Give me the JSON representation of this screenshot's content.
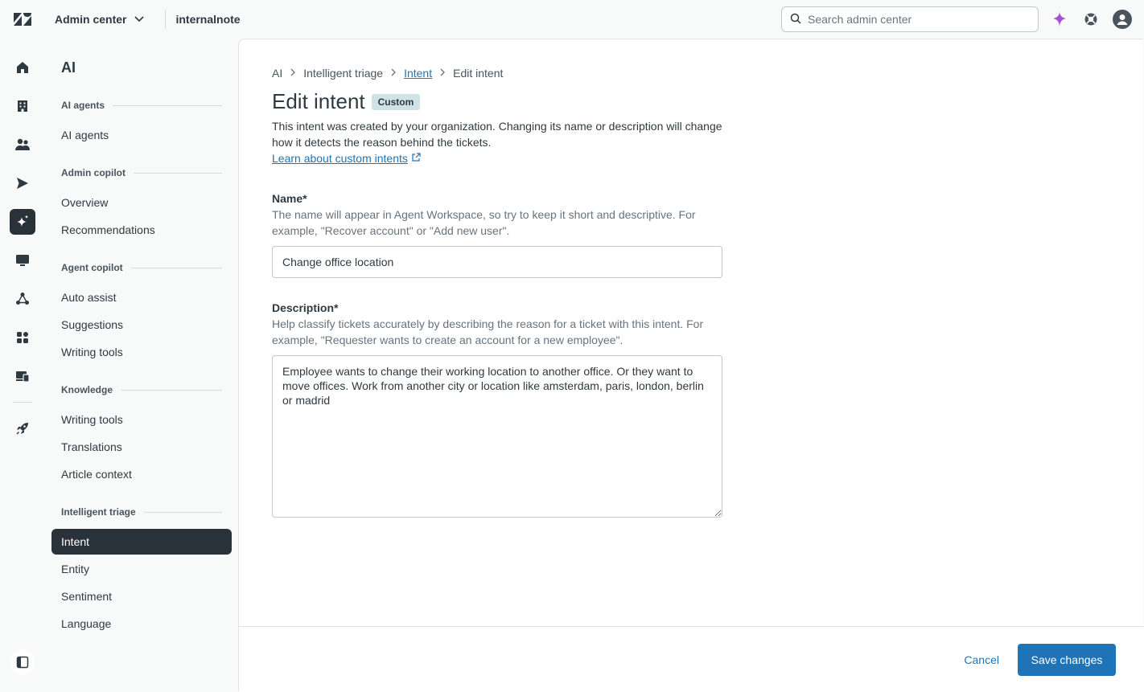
{
  "topbar": {
    "product_label": "Admin center",
    "account_name": "internalnote",
    "search_placeholder": "Search admin center"
  },
  "subnav": {
    "title": "AI",
    "sections": [
      {
        "heading": "AI agents",
        "items": [
          "AI agents"
        ]
      },
      {
        "heading": "Admin copilot",
        "items": [
          "Overview",
          "Recommendations"
        ]
      },
      {
        "heading": "Agent copilot",
        "items": [
          "Auto assist",
          "Suggestions",
          "Writing tools"
        ]
      },
      {
        "heading": "Knowledge",
        "items": [
          "Writing tools",
          "Translations",
          "Article context"
        ]
      },
      {
        "heading": "Intelligent triage",
        "items": [
          "Intent",
          "Entity",
          "Sentiment",
          "Language"
        ]
      }
    ],
    "active_item": "Intent"
  },
  "breadcrumb": [
    "AI",
    "Intelligent triage",
    "Intent",
    "Edit intent"
  ],
  "page": {
    "title": "Edit intent",
    "badge": "Custom",
    "intro": "This intent was created by your organization. Changing its name or description will change how it detects the reason behind the tickets.",
    "learn_link": "Learn about custom intents"
  },
  "form": {
    "name_label": "Name*",
    "name_hint": "The name will appear in Agent Workspace, so try to keep it short and descriptive. For example, \"Recover account\" or \"Add new user\".",
    "name_value": "Change office location",
    "description_label": "Description*",
    "description_hint": "Help classify tickets accurately by describing the reason for a ticket with this intent. For example, \"Requester wants to create an account for a new employee\".",
    "description_value": "Employee wants to change their working location to another office. Or they want to move offices. Work from another city or location like amsterdam, paris, london, berlin or madrid"
  },
  "footer": {
    "cancel_label": "Cancel",
    "save_label": "Save changes"
  },
  "colors": {
    "accent": "#1f73b7",
    "active_nav": "#293239",
    "badge_bg": "#cfe3e4",
    "ai_sparkle": "#a64cdb"
  }
}
